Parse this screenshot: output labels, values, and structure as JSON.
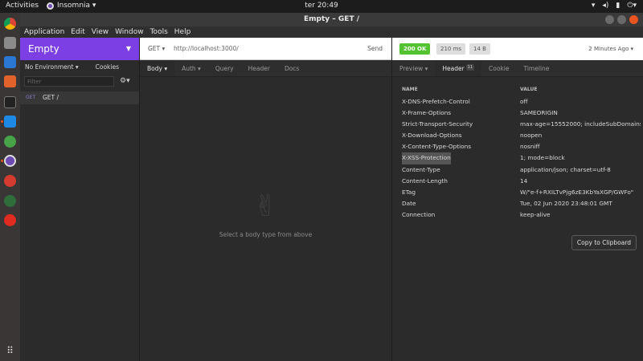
{
  "topbar": {
    "activities": "Activities",
    "app_name": "Insomnia ▾",
    "clock": "ter 20:49",
    "tray_icons": [
      "network-icon",
      "volume-icon",
      "battery-icon",
      "power-icon"
    ]
  },
  "window": {
    "title": "Empty – GET /"
  },
  "menu": [
    "Application",
    "Edit",
    "View",
    "Window",
    "Tools",
    "Help"
  ],
  "dock_icons": [
    "chrome-icon",
    "files-icon",
    "document-icon",
    "store-icon",
    "terminal-icon",
    "vscode-icon",
    "mongodb-icon",
    "insomnia-icon",
    "bug-icon",
    "web-icon",
    "youtube-icon",
    "apps-grid-icon"
  ],
  "sidebar": {
    "workspace": "Empty",
    "environment": "No Environment ▾",
    "cookies": "Cookies",
    "filter_placeholder": "Filter",
    "requests": [
      {
        "method": "GET",
        "name": "GET /"
      }
    ]
  },
  "request": {
    "method": "GET ▾",
    "url": "http://localhost:3000/",
    "send": "Send",
    "tabs": [
      "Body ▾",
      "Auth ▾",
      "Query",
      "Header",
      "Docs"
    ],
    "empty_message": "Select a body type from above"
  },
  "response": {
    "status": "200 OK",
    "time": "210 ms",
    "size": "14 B",
    "when": "2 Minutes Ago ▾",
    "tabs": [
      "Preview ▾",
      "Header",
      "Cookie",
      "Timeline"
    ],
    "header_count": "11",
    "columns": {
      "name": "NAME",
      "value": "VALUE"
    },
    "headers": [
      {
        "name": "X-DNS-Prefetch-Control",
        "value": "off"
      },
      {
        "name": "X-Frame-Options",
        "value": "SAMEORIGIN"
      },
      {
        "name": "Strict-Transport-Security",
        "value": "max-age=15552000; includeSubDomains"
      },
      {
        "name": "X-Download-Options",
        "value": "noopen"
      },
      {
        "name": "X-Content-Type-Options",
        "value": "nosniff"
      },
      {
        "name": "X-XSS-Protection",
        "value": "1; mode=block"
      },
      {
        "name": "Content-Type",
        "value": "application/json; charset=utf-8"
      },
      {
        "name": "Content-Length",
        "value": "14"
      },
      {
        "name": "ETag",
        "value": "W/\"e-f+RXILTvPjg6zE3KbYaXGP/GWFo\""
      },
      {
        "name": "Date",
        "value": "Tue, 02 Jun 2020 23:48:01 GMT"
      },
      {
        "name": "Connection",
        "value": "keep-alive"
      }
    ],
    "copy_button": "Copy to Clipboard"
  }
}
